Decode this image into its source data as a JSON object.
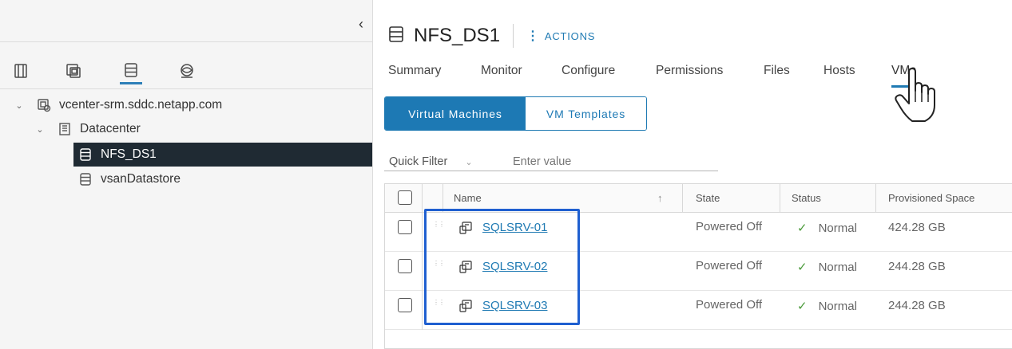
{
  "sidebar": {
    "collapse_icon": "chevron-left-icon",
    "nav_tabs": [
      {
        "icon": "hosts-clusters-icon"
      },
      {
        "icon": "vms-templates-icon"
      },
      {
        "icon": "storage-icon"
      },
      {
        "icon": "networking-icon"
      }
    ],
    "active_nav": 2,
    "tree": [
      {
        "label": "vcenter-srm.sddc.netapp.com",
        "icon": "vcenter-icon",
        "expanded": true
      },
      {
        "label": "Datacenter",
        "icon": "datacenter-icon",
        "expanded": true
      },
      {
        "label": "NFS_DS1",
        "icon": "datastore-icon",
        "selected": true
      },
      {
        "label": "vsanDatastore",
        "icon": "datastore-icon"
      }
    ]
  },
  "header": {
    "title": "NFS_DS1",
    "actions_label": "ACTIONS"
  },
  "tabs": [
    {
      "label": "Summary"
    },
    {
      "label": "Monitor"
    },
    {
      "label": "Configure"
    },
    {
      "label": "Permissions"
    },
    {
      "label": "Files"
    },
    {
      "label": "Hosts"
    },
    {
      "label": "VMs",
      "active": true
    }
  ],
  "segments": {
    "virtual_machines": "Virtual Machines",
    "vm_templates": "VM Templates"
  },
  "filter": {
    "select_value": "Quick Filter",
    "input_placeholder": "Enter value"
  },
  "table": {
    "headers": {
      "name": "Name",
      "state": "State",
      "status": "Status",
      "provisioned_space": "Provisioned Space"
    },
    "sort_icon": "arrow-up-icon",
    "rows": [
      {
        "name": "SQLSRV-01",
        "state": "Powered Off",
        "status": "Normal",
        "provisioned_space": "424.28 GB"
      },
      {
        "name": "SQLSRV-02",
        "state": "Powered Off",
        "status": "Normal",
        "provisioned_space": "244.28 GB"
      },
      {
        "name": "SQLSRV-03",
        "state": "Powered Off",
        "status": "Normal",
        "provisioned_space": "244.28 GB"
      }
    ]
  },
  "colors": {
    "accent": "#1d79b4",
    "selected_bg": "#1f2a33",
    "highlight_box": "#1f5fd0",
    "status_ok": "#4a9a3a"
  }
}
